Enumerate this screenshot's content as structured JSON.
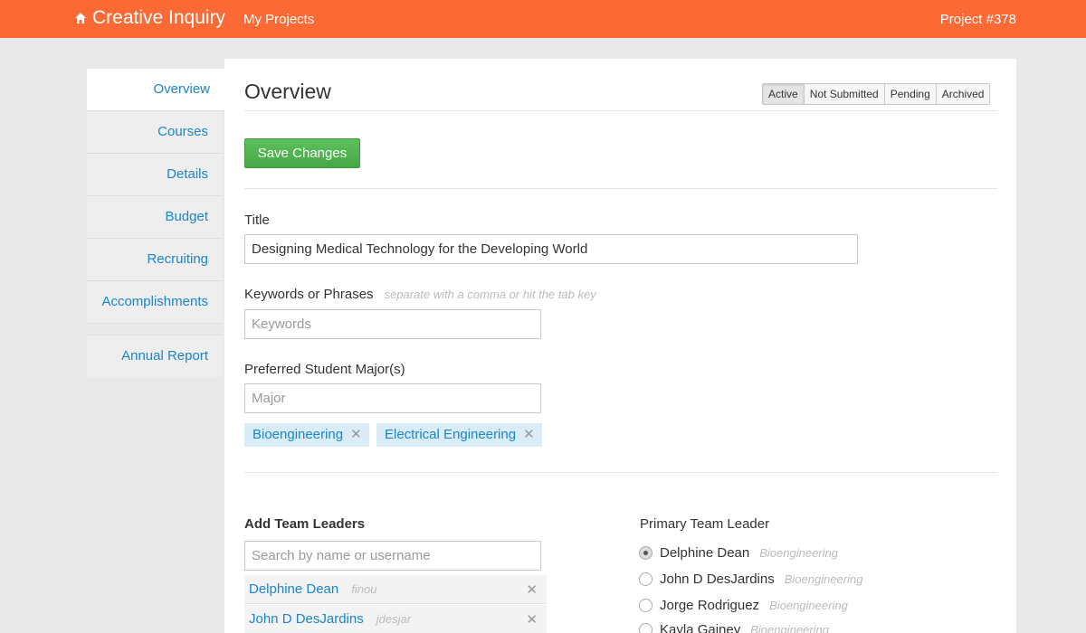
{
  "header": {
    "brand": "Creative Inquiry",
    "home_icon": "home-icon",
    "nav_link": "My Projects",
    "project_number": "Project #378"
  },
  "sidebar": {
    "items": [
      {
        "label": "Overview",
        "active": true
      },
      {
        "label": "Courses"
      },
      {
        "label": "Details"
      },
      {
        "label": "Budget"
      },
      {
        "label": "Recruiting"
      },
      {
        "label": "Accomplishments"
      }
    ],
    "annual_report": "Annual Report"
  },
  "main": {
    "title": "Overview",
    "filters": [
      "Active",
      "Not Submitted",
      "Pending",
      "Archived"
    ],
    "selected_filter": "Active",
    "save_button": "Save Changes"
  },
  "form": {
    "title_label": "Title",
    "title_value": "Designing Medical Technology for the Developing World",
    "keywords_label": "Keywords or Phrases",
    "keywords_hint": "separate with a comma or hit the tab key",
    "keywords_placeholder": "Keywords",
    "major_label": "Preferred Student Major(s)",
    "major_placeholder": "Major",
    "majors": [
      "Bioengineering",
      "Electrical Engineering"
    ]
  },
  "team": {
    "add_label": "Add Team Leaders",
    "search_placeholder": "Search by name or username",
    "leaders": [
      {
        "name": "Delphine Dean",
        "username": "finou"
      },
      {
        "name": "John D DesJardins",
        "username": "jdesjar"
      }
    ],
    "primary_label": "Primary Team Leader",
    "primary_options": [
      {
        "name": "Delphine Dean",
        "dept": "Bioengineering",
        "checked": true
      },
      {
        "name": "John D DesJardins",
        "dept": "Bioengineering"
      },
      {
        "name": "Jorge Rodriguez",
        "dept": "Bioengineering"
      },
      {
        "name": "Kayla Gainey",
        "dept": "Bioengineering"
      }
    ]
  },
  "colors": {
    "header": "#fb6a35",
    "link": "#1a86c8",
    "save": "#4cae4c",
    "tag_bg": "#d9ecf7"
  }
}
